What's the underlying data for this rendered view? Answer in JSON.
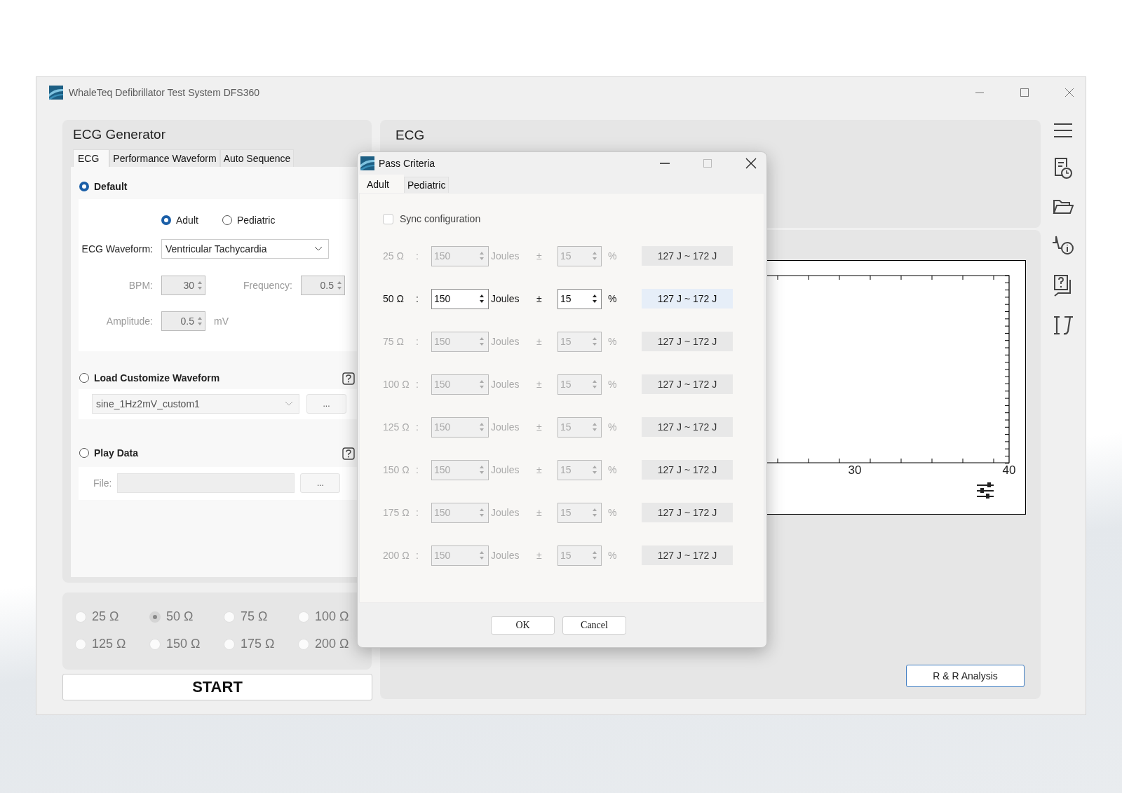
{
  "window": {
    "title": "WhaleTeq Defibrillator Test System DFS360"
  },
  "ecg_generator": {
    "title": "ECG Generator",
    "tabs": [
      {
        "label": "ECG",
        "selected": true
      },
      {
        "label": "Performance Waveform",
        "selected": false
      },
      {
        "label": "Auto Sequence",
        "selected": false
      }
    ],
    "default": {
      "label": "Default",
      "selected": true,
      "patient": [
        {
          "label": "Adult",
          "selected": true
        },
        {
          "label": "Pediatric",
          "selected": false
        }
      ],
      "waveform": {
        "label": "ECG Waveform:",
        "value": "Ventricular Tachycardia"
      },
      "bpm": {
        "label": "BPM:",
        "value": "30",
        "disabled": true
      },
      "frequency": {
        "label": "Frequency:",
        "value": "0.5",
        "disabled": true
      },
      "amplitude": {
        "label": "Amplitude:",
        "value": "0.5",
        "unit": "mV",
        "disabled": true
      }
    },
    "custom": {
      "label": "Load Customize Waveform",
      "selected": false,
      "file": "sine_1Hz2mV_custom1",
      "browse": "..."
    },
    "play_data": {
      "label": "Play Data",
      "selected": false,
      "file_label": "File:",
      "browse": "..."
    }
  },
  "impedance": {
    "disabled": true,
    "options": [
      {
        "label": "25 Ω",
        "selected": false
      },
      {
        "label": "50 Ω",
        "selected": true
      },
      {
        "label": "75 Ω",
        "selected": false
      },
      {
        "label": "100 Ω",
        "selected": false
      },
      {
        "label": "125 Ω",
        "selected": false
      },
      {
        "label": "150 Ω",
        "selected": false
      },
      {
        "label": "175 Ω",
        "selected": false
      },
      {
        "label": "200 Ω",
        "selected": false
      }
    ]
  },
  "start_button": "START",
  "ecg_panel": {
    "title": "ECG",
    "x_tick_labels": [
      "30",
      "40"
    ],
    "analysis_button": "R & R Analysis"
  },
  "dialog": {
    "title": "Pass Criteria",
    "tabs": [
      {
        "label": "Adult",
        "selected": true
      },
      {
        "label": "Pediatric",
        "selected": false
      }
    ],
    "sync": {
      "label": "Sync configuration",
      "checked": false
    },
    "rows": [
      {
        "impedance": "25 Ω",
        "separator": ":",
        "energy": "150",
        "unit": "Joules",
        "plus_minus": "±",
        "tolerance": "15",
        "percent": "%",
        "range": "127 J ~ 172 J",
        "enabled": false
      },
      {
        "impedance": "50 Ω",
        "separator": ":",
        "energy": "150",
        "unit": "Joules",
        "plus_minus": "±",
        "tolerance": "15",
        "percent": "%",
        "range": "127 J ~ 172 J",
        "enabled": true
      },
      {
        "impedance": "75 Ω",
        "separator": ":",
        "energy": "150",
        "unit": "Joules",
        "plus_minus": "±",
        "tolerance": "15",
        "percent": "%",
        "range": "127 J ~ 172 J",
        "enabled": false
      },
      {
        "impedance": "100 Ω",
        "separator": ":",
        "energy": "150",
        "unit": "Joules",
        "plus_minus": "±",
        "tolerance": "15",
        "percent": "%",
        "range": "127 J ~ 172 J",
        "enabled": false
      },
      {
        "impedance": "125 Ω",
        "separator": ":",
        "energy": "150",
        "unit": "Joules",
        "plus_minus": "±",
        "tolerance": "15",
        "percent": "%",
        "range": "127 J ~ 172 J",
        "enabled": false
      },
      {
        "impedance": "150 Ω",
        "separator": ":",
        "energy": "150",
        "unit": "Joules",
        "plus_minus": "±",
        "tolerance": "15",
        "percent": "%",
        "range": "127 J ~ 172 J",
        "enabled": false
      },
      {
        "impedance": "175 Ω",
        "separator": ":",
        "energy": "150",
        "unit": "Joules",
        "plus_minus": "±",
        "tolerance": "15",
        "percent": "%",
        "range": "127 J ~ 172 J",
        "enabled": false
      },
      {
        "impedance": "200 Ω",
        "separator": ":",
        "energy": "150",
        "unit": "Joules",
        "plus_minus": "±",
        "tolerance": "15",
        "percent": "%",
        "range": "127 J ~ 172 J",
        "enabled": false
      }
    ],
    "buttons": [
      "OK",
      "Cancel"
    ]
  }
}
